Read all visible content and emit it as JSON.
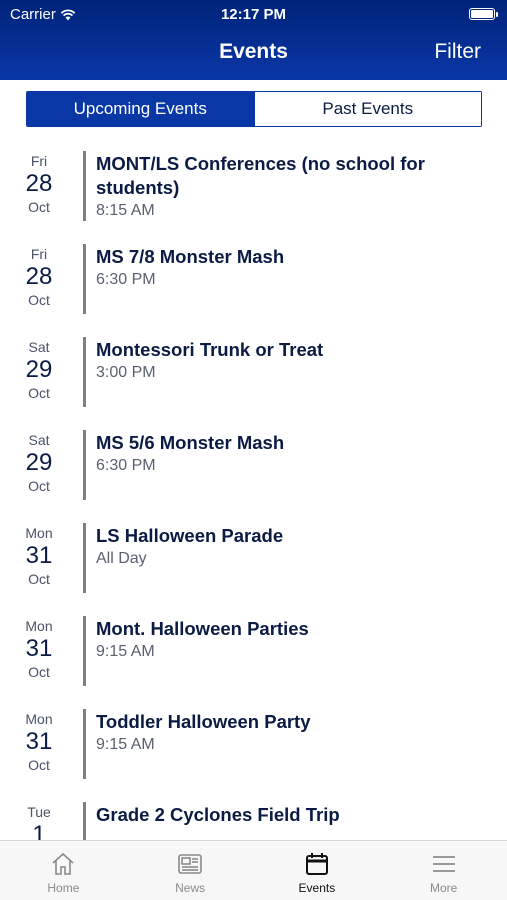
{
  "status": {
    "carrier": "Carrier",
    "time": "12:17 PM"
  },
  "header": {
    "title": "Events",
    "filter_label": "Filter"
  },
  "segments": {
    "upcoming": "Upcoming Events",
    "past": "Past Events",
    "selected": "Upcoming Events"
  },
  "events": [
    {
      "dow": "Fri",
      "day": "28",
      "month": "Oct",
      "title": "MONT/LS Conferences (no school for students)",
      "time": "8:15 AM"
    },
    {
      "dow": "Fri",
      "day": "28",
      "month": "Oct",
      "title": "MS 7/8 Monster Mash",
      "time": "6:30 PM"
    },
    {
      "dow": "Sat",
      "day": "29",
      "month": "Oct",
      "title": "Montessori Trunk or Treat",
      "time": "3:00 PM"
    },
    {
      "dow": "Sat",
      "day": "29",
      "month": "Oct",
      "title": "MS 5/6 Monster Mash",
      "time": "6:30 PM"
    },
    {
      "dow": "Mon",
      "day": "31",
      "month": "Oct",
      "title": "LS Halloween Parade",
      "time": "All Day"
    },
    {
      "dow": "Mon",
      "day": "31",
      "month": "Oct",
      "title": "Mont. Halloween Parties",
      "time": "9:15 AM"
    },
    {
      "dow": "Mon",
      "day": "31",
      "month": "Oct",
      "title": "Toddler Halloween Party",
      "time": "9:15 AM"
    },
    {
      "dow": "Tue",
      "day": "1",
      "month": "",
      "title": "Grade 2 Cyclones Field Trip",
      "time": ""
    }
  ],
  "tabs": [
    {
      "label": "Home",
      "icon": "home-icon"
    },
    {
      "label": "News",
      "icon": "news-icon"
    },
    {
      "label": "Events",
      "icon": "calendar-icon",
      "active": true
    },
    {
      "label": "More",
      "icon": "menu-icon"
    }
  ],
  "colors": {
    "header": "#0a37a6",
    "text": "#0b1b44",
    "divider": "#7b7f88"
  }
}
